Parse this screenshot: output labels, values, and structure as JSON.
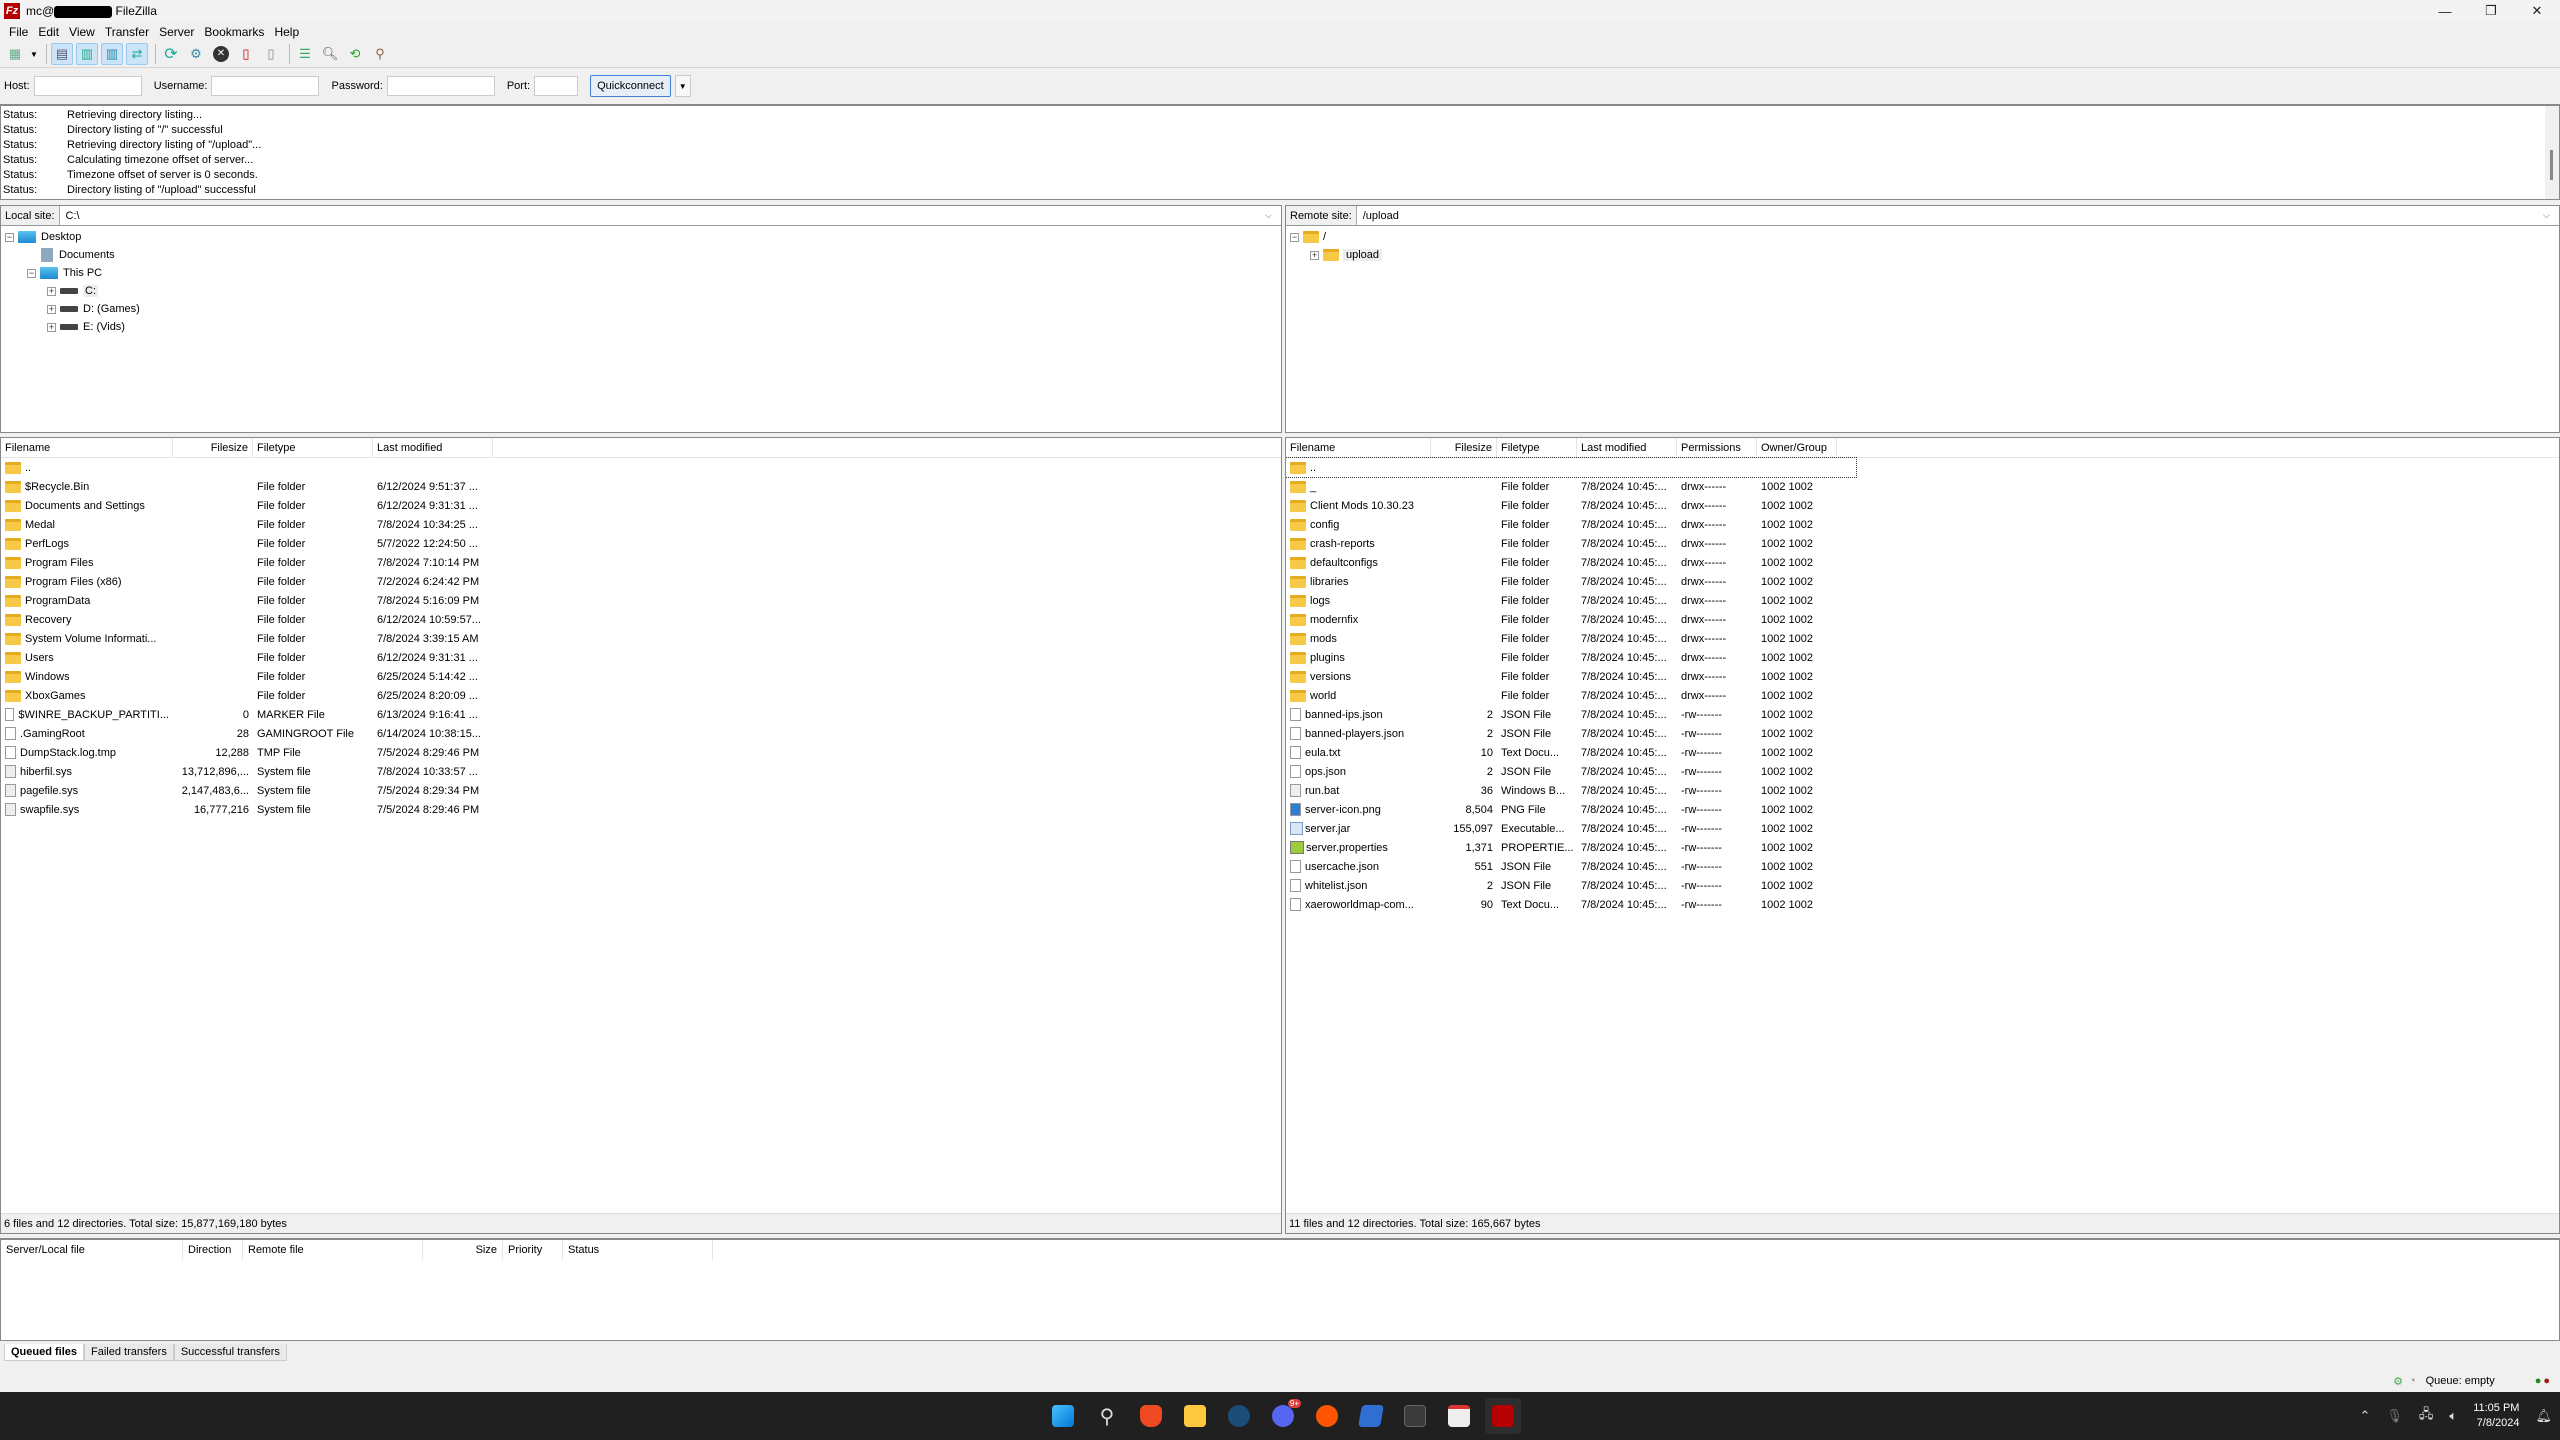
{
  "window": {
    "title_prefix": "mc@",
    "title_suffix": "FileZilla",
    "app_icon": "Fz",
    "controls": {
      "minimize": "—",
      "maximize": "❐",
      "close": "✕"
    }
  },
  "menu": [
    "File",
    "Edit",
    "View",
    "Transfer",
    "Server",
    "Bookmarks",
    "Help"
  ],
  "toolbar": {
    "icons": [
      "site-manager-icon",
      "toggle-message-log-icon",
      "toggle-local-tree-icon",
      "toggle-remote-tree-icon",
      "toggle-transfer-queue-icon",
      "refresh-icon",
      "process-queue-icon",
      "cancel-icon",
      "disconnect-icon",
      "reconnect-icon",
      "filter-icon",
      "compare-icon",
      "synchronized-browsing-icon",
      "search-icon"
    ]
  },
  "quickconnect": {
    "host_label": "Host:",
    "host_value": "",
    "username_label": "Username:",
    "username_value": "",
    "password_label": "Password:",
    "password_value": "",
    "port_label": "Port:",
    "port_value": "",
    "button": "Quickconnect"
  },
  "log": [
    {
      "label": "Status:",
      "text": "Retrieving directory listing..."
    },
    {
      "label": "Status:",
      "text": "Directory listing of \"/\" successful"
    },
    {
      "label": "Status:",
      "text": "Retrieving directory listing of \"/upload\"..."
    },
    {
      "label": "Status:",
      "text": "Calculating timezone offset of server..."
    },
    {
      "label": "Status:",
      "text": "Timezone offset of server is 0 seconds."
    },
    {
      "label": "Status:",
      "text": "Directory listing of \"/upload\" successful"
    }
  ],
  "local": {
    "site_label": "Local site:",
    "path": "C:\\",
    "tree": [
      "Desktop",
      "Documents",
      "This PC",
      "C:",
      "D: (Games)",
      "E: (Vids)"
    ],
    "columns": [
      "Filename",
      "Filesize",
      "Filetype",
      "Last modified"
    ],
    "files": [
      {
        "name": "..",
        "size": "",
        "type": "",
        "modified": "",
        "icon": "folder"
      },
      {
        "name": "$Recycle.Bin",
        "size": "",
        "type": "File folder",
        "modified": "6/12/2024 9:51:37 ...",
        "icon": "folder"
      },
      {
        "name": "Documents and Settings",
        "size": "",
        "type": "File folder",
        "modified": "6/12/2024 9:31:31 ...",
        "icon": "folder"
      },
      {
        "name": "Medal",
        "size": "",
        "type": "File folder",
        "modified": "7/8/2024 10:34:25 ...",
        "icon": "folder"
      },
      {
        "name": "PerfLogs",
        "size": "",
        "type": "File folder",
        "modified": "5/7/2022 12:24:50 ...",
        "icon": "folder"
      },
      {
        "name": "Program Files",
        "size": "",
        "type": "File folder",
        "modified": "7/8/2024 7:10:14 PM",
        "icon": "folder"
      },
      {
        "name": "Program Files (x86)",
        "size": "",
        "type": "File folder",
        "modified": "7/2/2024 6:24:42 PM",
        "icon": "folder"
      },
      {
        "name": "ProgramData",
        "size": "",
        "type": "File folder",
        "modified": "7/8/2024 5:16:09 PM",
        "icon": "folder"
      },
      {
        "name": "Recovery",
        "size": "",
        "type": "File folder",
        "modified": "6/12/2024 10:59:57...",
        "icon": "folder"
      },
      {
        "name": "System Volume Informati...",
        "size": "",
        "type": "File folder",
        "modified": "7/8/2024 3:39:15 AM",
        "icon": "folder"
      },
      {
        "name": "Users",
        "size": "",
        "type": "File folder",
        "modified": "6/12/2024 9:31:31 ...",
        "icon": "folder"
      },
      {
        "name": "Windows",
        "size": "",
        "type": "File folder",
        "modified": "6/25/2024 5:14:42 ...",
        "icon": "folder"
      },
      {
        "name": "XboxGames",
        "size": "",
        "type": "File folder",
        "modified": "6/25/2024 8:20:09 ...",
        "icon": "folder"
      },
      {
        "name": "$WINRE_BACKUP_PARTITI...",
        "size": "0",
        "type": "MARKER File",
        "modified": "6/13/2024 9:16:41 ...",
        "icon": "file"
      },
      {
        "name": ".GamingRoot",
        "size": "28",
        "type": "GAMINGROOT File",
        "modified": "6/14/2024 10:38:15...",
        "icon": "file"
      },
      {
        "name": "DumpStack.log.tmp",
        "size": "12,288",
        "type": "TMP File",
        "modified": "7/5/2024 8:29:46 PM",
        "icon": "file"
      },
      {
        "name": "hiberfil.sys",
        "size": "13,712,896,...",
        "type": "System file",
        "modified": "7/8/2024 10:33:57 ...",
        "icon": "sys"
      },
      {
        "name": "pagefile.sys",
        "size": "2,147,483,6...",
        "type": "System file",
        "modified": "7/5/2024 8:29:34 PM",
        "icon": "sys"
      },
      {
        "name": "swapfile.sys",
        "size": "16,777,216",
        "type": "System file",
        "modified": "7/5/2024 8:29:46 PM",
        "icon": "sys"
      }
    ],
    "summary": "6 files and 12 directories. Total size: 15,877,169,180 bytes"
  },
  "remote": {
    "site_label": "Remote site:",
    "path": "/upload",
    "tree": [
      "/",
      "upload"
    ],
    "columns": [
      "Filename",
      "Filesize",
      "Filetype",
      "Last modified",
      "Permissions",
      "Owner/Group"
    ],
    "files": [
      {
        "name": "..",
        "size": "",
        "type": "",
        "modified": "",
        "perms": "",
        "owner": "",
        "icon": "folder"
      },
      {
        "name": "_",
        "size": "",
        "type": "File folder",
        "modified": "7/8/2024 10:45:...",
        "perms": "drwx------",
        "owner": "1002 1002",
        "icon": "folder"
      },
      {
        "name": "Client Mods 10.30.23",
        "size": "",
        "type": "File folder",
        "modified": "7/8/2024 10:45:...",
        "perms": "drwx------",
        "owner": "1002 1002",
        "icon": "folder"
      },
      {
        "name": "config",
        "size": "",
        "type": "File folder",
        "modified": "7/8/2024 10:45:...",
        "perms": "drwx------",
        "owner": "1002 1002",
        "icon": "folder"
      },
      {
        "name": "crash-reports",
        "size": "",
        "type": "File folder",
        "modified": "7/8/2024 10:45:...",
        "perms": "drwx------",
        "owner": "1002 1002",
        "icon": "folder"
      },
      {
        "name": "defaultconfigs",
        "size": "",
        "type": "File folder",
        "modified": "7/8/2024 10:45:...",
        "perms": "drwx------",
        "owner": "1002 1002",
        "icon": "folder"
      },
      {
        "name": "libraries",
        "size": "",
        "type": "File folder",
        "modified": "7/8/2024 10:45:...",
        "perms": "drwx------",
        "owner": "1002 1002",
        "icon": "folder"
      },
      {
        "name": "logs",
        "size": "",
        "type": "File folder",
        "modified": "7/8/2024 10:45:...",
        "perms": "drwx------",
        "owner": "1002 1002",
        "icon": "folder"
      },
      {
        "name": "modernfix",
        "size": "",
        "type": "File folder",
        "modified": "7/8/2024 10:45:...",
        "perms": "drwx------",
        "owner": "1002 1002",
        "icon": "folder"
      },
      {
        "name": "mods",
        "size": "",
        "type": "File folder",
        "modified": "7/8/2024 10:45:...",
        "perms": "drwx------",
        "owner": "1002 1002",
        "icon": "folder"
      },
      {
        "name": "plugins",
        "size": "",
        "type": "File folder",
        "modified": "7/8/2024 10:45:...",
        "perms": "drwx------",
        "owner": "1002 1002",
        "icon": "folder"
      },
      {
        "name": "versions",
        "size": "",
        "type": "File folder",
        "modified": "7/8/2024 10:45:...",
        "perms": "drwx------",
        "owner": "1002 1002",
        "icon": "folder"
      },
      {
        "name": "world",
        "size": "",
        "type": "File folder",
        "modified": "7/8/2024 10:45:...",
        "perms": "drwx------",
        "owner": "1002 1002",
        "icon": "folder"
      },
      {
        "name": "banned-ips.json",
        "size": "2",
        "type": "JSON File",
        "modified": "7/8/2024 10:45:...",
        "perms": "-rw-------",
        "owner": "1002 1002",
        "icon": "file"
      },
      {
        "name": "banned-players.json",
        "size": "2",
        "type": "JSON File",
        "modified": "7/8/2024 10:45:...",
        "perms": "-rw-------",
        "owner": "1002 1002",
        "icon": "file"
      },
      {
        "name": "eula.txt",
        "size": "10",
        "type": "Text Docu...",
        "modified": "7/8/2024 10:45:...",
        "perms": "-rw-------",
        "owner": "1002 1002",
        "icon": "file"
      },
      {
        "name": "ops.json",
        "size": "2",
        "type": "JSON File",
        "modified": "7/8/2024 10:45:...",
        "perms": "-rw-------",
        "owner": "1002 1002",
        "icon": "file"
      },
      {
        "name": "run.bat",
        "size": "36",
        "type": "Windows B...",
        "modified": "7/8/2024 10:45:...",
        "perms": "-rw-------",
        "owner": "1002 1002",
        "icon": "sys"
      },
      {
        "name": "server-icon.png",
        "size": "8,504",
        "type": "PNG File",
        "modified": "7/8/2024 10:45:...",
        "perms": "-rw-------",
        "owner": "1002 1002",
        "icon": "img"
      },
      {
        "name": "server.jar",
        "size": "155,097",
        "type": "Executable...",
        "modified": "7/8/2024 10:45:...",
        "perms": "-rw-------",
        "owner": "1002 1002",
        "icon": "jar"
      },
      {
        "name": "server.properties",
        "size": "1,371",
        "type": "PROPERTIE...",
        "modified": "7/8/2024 10:45:...",
        "perms": "-rw-------",
        "owner": "1002 1002",
        "icon": "prop"
      },
      {
        "name": "usercache.json",
        "size": "551",
        "type": "JSON File",
        "modified": "7/8/2024 10:45:...",
        "perms": "-rw-------",
        "owner": "1002 1002",
        "icon": "file"
      },
      {
        "name": "whitelist.json",
        "size": "2",
        "type": "JSON File",
        "modified": "7/8/2024 10:45:...",
        "perms": "-rw-------",
        "owner": "1002 1002",
        "icon": "file"
      },
      {
        "name": "xaeroworldmap-com...",
        "size": "90",
        "type": "Text Docu...",
        "modified": "7/8/2024 10:45:...",
        "perms": "-rw-------",
        "owner": "1002 1002",
        "icon": "file"
      }
    ],
    "summary": "11 files and 12 directories. Total size: 165,667 bytes"
  },
  "queue": {
    "columns": [
      "Server/Local file",
      "Direction",
      "Remote file",
      "Size",
      "Priority",
      "Status"
    ],
    "tabs": [
      "Queued files",
      "Failed transfers",
      "Successful transfers"
    ],
    "status": "Queue: empty"
  },
  "taskbar": {
    "apps": [
      "start",
      "search",
      "brave",
      "file-explorer",
      "steam",
      "discord",
      "soundcloud",
      "powershell",
      "terminal",
      "snipping-tool",
      "filezilla"
    ],
    "discord_badge": "9+",
    "time": "11:05 PM",
    "date": "7/8/2024"
  },
  "colors": {
    "accent": "#3f7fd3",
    "filezilla_red": "#b40000",
    "folder": "#f7c948"
  }
}
